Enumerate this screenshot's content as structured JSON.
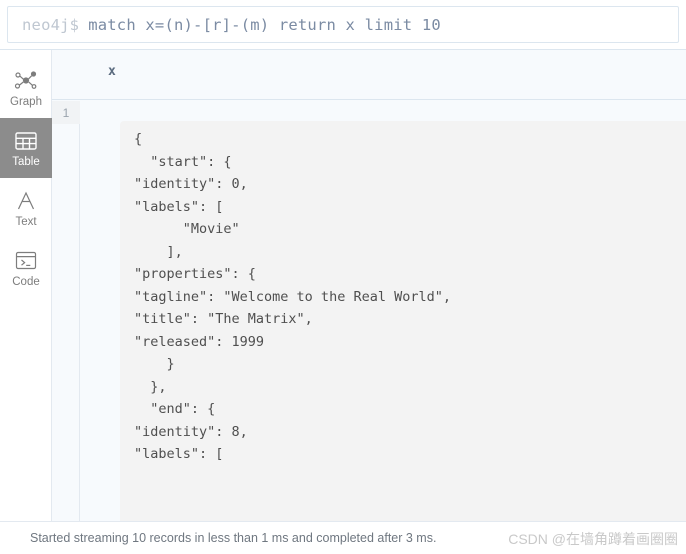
{
  "editor": {
    "prompt": "neo4j$",
    "query": "match x=(n)-[r]-(m) return x limit 10"
  },
  "sidebar": {
    "items": [
      {
        "label": "Graph",
        "icon": "graph-icon",
        "active": false
      },
      {
        "label": "Table",
        "icon": "table-icon",
        "active": true
      },
      {
        "label": "Text",
        "icon": "text-icon",
        "active": false
      },
      {
        "label": "Code",
        "icon": "code-icon",
        "active": false
      }
    ],
    "active_background": "#8c8c8c"
  },
  "table": {
    "columns": [
      "x"
    ],
    "row_numbers": [
      "1"
    ],
    "cell_json": "{\n  \"start\": {\n\"identity\": 0,\n\"labels\": [\n      \"Movie\"\n    ],\n\"properties\": {\n\"tagline\": \"Welcome to the Real World\",\n\"title\": \"The Matrix\",\n\"released\": 1999\n    }\n  },\n  \"end\": {\n\"identity\": 8,\n\"labels\": ["
  },
  "status": {
    "message": "Started streaming 10 records in less than 1 ms and completed after 3 ms.",
    "watermark": "CSDN @在墙角蹲着画圈圈"
  }
}
